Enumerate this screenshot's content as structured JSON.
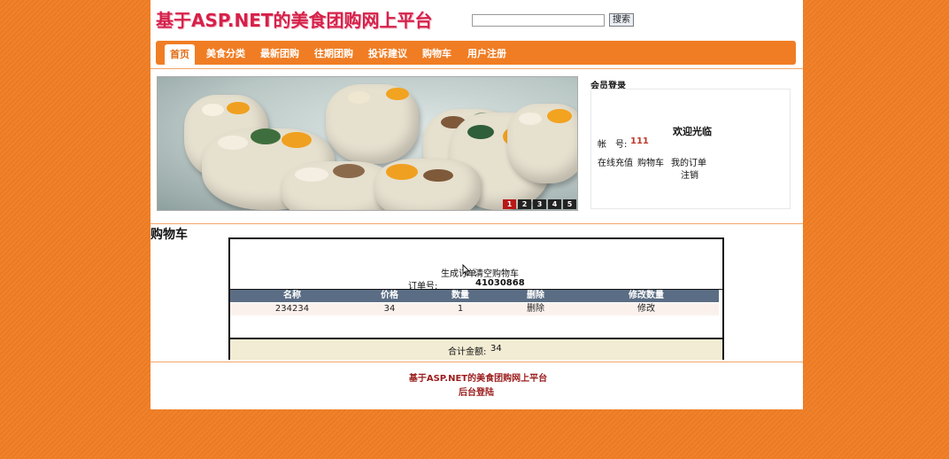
{
  "site": {
    "title": "基于ASP.NET的美食团购网上平台"
  },
  "search": {
    "placeholder": "",
    "button_label": "搜索"
  },
  "nav": {
    "items": [
      {
        "label": "首页",
        "active": true
      },
      {
        "label": "美食分类"
      },
      {
        "label": "最新团购"
      },
      {
        "label": "往期团购"
      },
      {
        "label": "投诉建议"
      },
      {
        "label": "购物车"
      },
      {
        "label": "用户注册"
      }
    ]
  },
  "banner": {
    "pages": [
      "1",
      "2",
      "3",
      "4",
      "5"
    ],
    "active_page": "1"
  },
  "login": {
    "title": "会员登录",
    "welcome": "欢迎光临",
    "account_label": "帐　号:",
    "account_value": "111",
    "links": [
      "在线充值",
      "购物车",
      "我的订单",
      "注销"
    ]
  },
  "cart": {
    "title": "购物车",
    "generate_order_label": "生成订单",
    "clear_cart_label": "清空购物车",
    "order_no_label": "订单号:",
    "order_no_value": "41030868",
    "columns": [
      "名称",
      "价格",
      "数量",
      "删除",
      "修改数量"
    ],
    "rows": [
      {
        "name": "234234",
        "price": "34",
        "qty": "1",
        "delete": "删除",
        "modify": "修改"
      }
    ],
    "total_label": "合计金额:",
    "total_value": "34"
  },
  "footer": {
    "site_link": "基于ASP.NET的美食团购网上平台",
    "admin_login": "后台登陆"
  },
  "colors": {
    "background": "#f07d24",
    "nav": "#f07d24",
    "table_header": "#5b6d84",
    "title": "#d6214a",
    "footer_text": "#9b1c1c"
  }
}
